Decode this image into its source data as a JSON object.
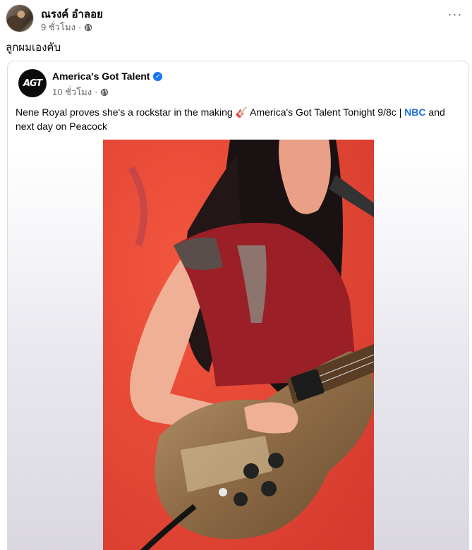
{
  "post": {
    "author": "ณรงค์ อำลอย",
    "time": "9 ชั่วโมง",
    "separator": "·",
    "text": "ลูกผมเองคับ",
    "more_label": "···"
  },
  "shared": {
    "logo_text": "AGT",
    "page_name": "America's Got Talent",
    "time": "10 ชั่วโมง",
    "separator": "·",
    "caption_part1": "Nene Royal proves she's a rockstar in the making 🎸 America's Got Talent Tonight 9/8c | ",
    "caption_link": "NBC",
    "caption_part2": " and next day on Peacock"
  },
  "icons": {
    "globe": "globe-icon",
    "verified": "verified-badge-icon",
    "more": "more-options-icon"
  },
  "colors": {
    "link": "#216fdb",
    "verified": "#1877f2",
    "meta": "#65676b",
    "stage_bg": "#ee4a3a"
  }
}
